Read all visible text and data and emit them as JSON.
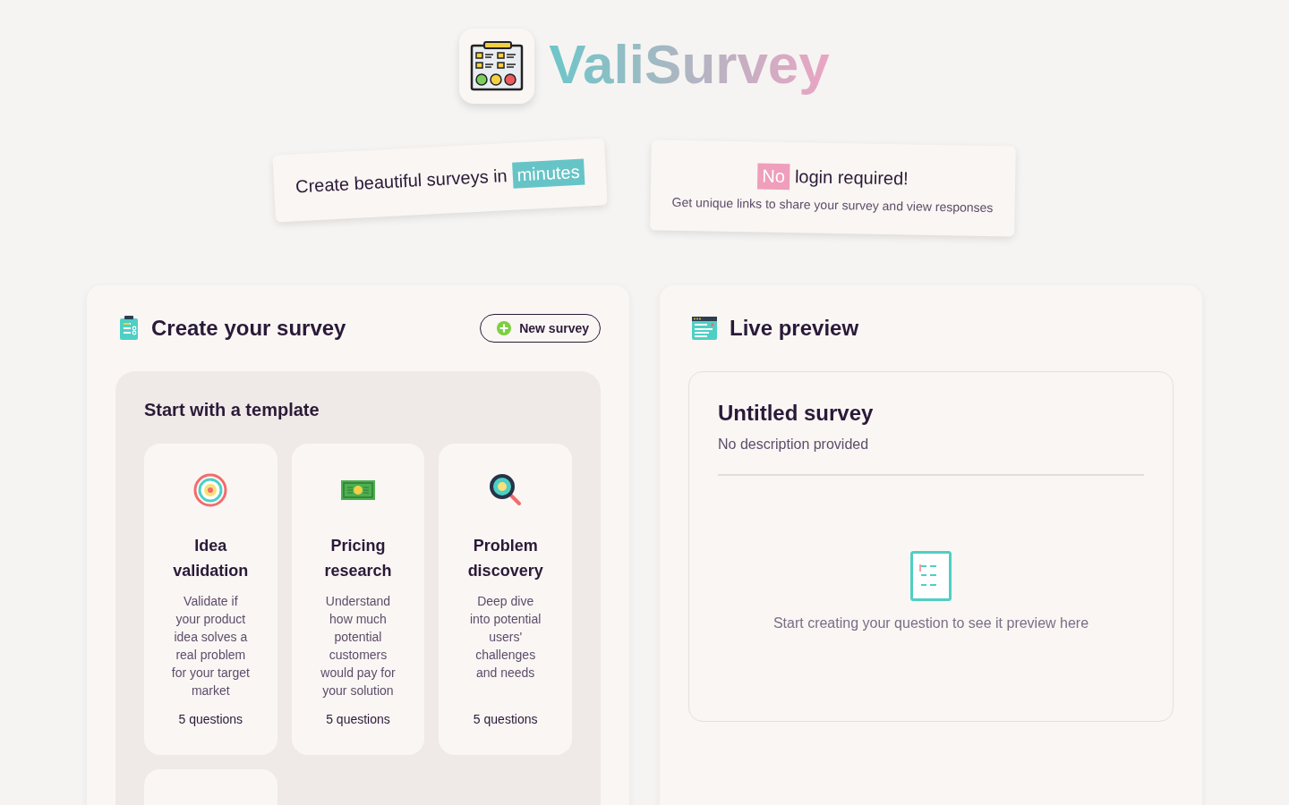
{
  "brand": {
    "name": "ValiSurvey"
  },
  "taglines": [
    {
      "parts": [
        {
          "text": "Create beautiful surveys in",
          "highlight": false
        },
        {
          "text": "minutes",
          "highlight": true
        }
      ]
    },
    {
      "parts": [
        {
          "text": "No",
          "highlight": true
        },
        {
          "text": "login required!",
          "highlight": false
        }
      ],
      "subtext": "Get unique links to share your survey and view responses"
    }
  ],
  "create_panel": {
    "title": "Create your survey",
    "new_button": "New survey",
    "templates_title": "Start with a template",
    "templates": [
      {
        "name": "Idea validation",
        "description": "Validate if your product idea solves a real problem for your target market",
        "count": "5 questions"
      },
      {
        "name": "Pricing research",
        "description": "Understand how much potential customers would pay for your solution",
        "count": "5 questions"
      },
      {
        "name": "Problem discovery",
        "description": "Deep dive into potential users' challenges and needs",
        "count": "5 questions"
      }
    ]
  },
  "preview_panel": {
    "title": "Live preview",
    "survey_title": "Untitled survey",
    "survey_description": "No description provided",
    "empty_message": "Start creating your question to see it preview here"
  }
}
